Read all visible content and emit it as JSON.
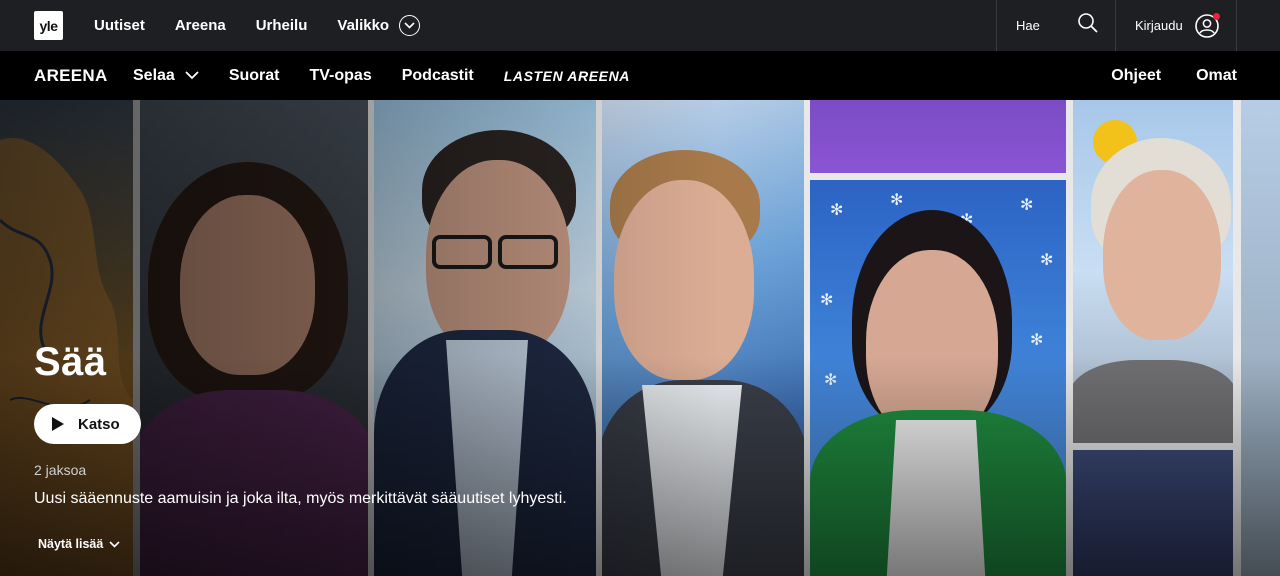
{
  "topbar": {
    "logo_text": "yle",
    "nav": [
      "Uutiset",
      "Areena",
      "Urheilu",
      "Valikko"
    ],
    "search_label": "Hae",
    "login_label": "Kirjaudu"
  },
  "areenabar": {
    "brand": "AREENA",
    "nav": [
      "Selaa",
      "Suorat",
      "TV-opas",
      "Podcastit",
      "LASTEN AREENA"
    ],
    "right": [
      "Ohjeet",
      "Omat"
    ]
  },
  "hero": {
    "title": "Sää",
    "watch_label": "Katso",
    "episodes": "2 jaksoa",
    "description": "Uusi sääennuste aamuisin ja joka ilta, myös merkittävät sääuutiset lyhyesti.",
    "show_more": "Näytä lisää"
  },
  "colors": {
    "topbar_bg": "#1e1f22",
    "areena_bg": "#000000",
    "button_bg": "#ffffff",
    "notification_dot": "#e5263a"
  }
}
